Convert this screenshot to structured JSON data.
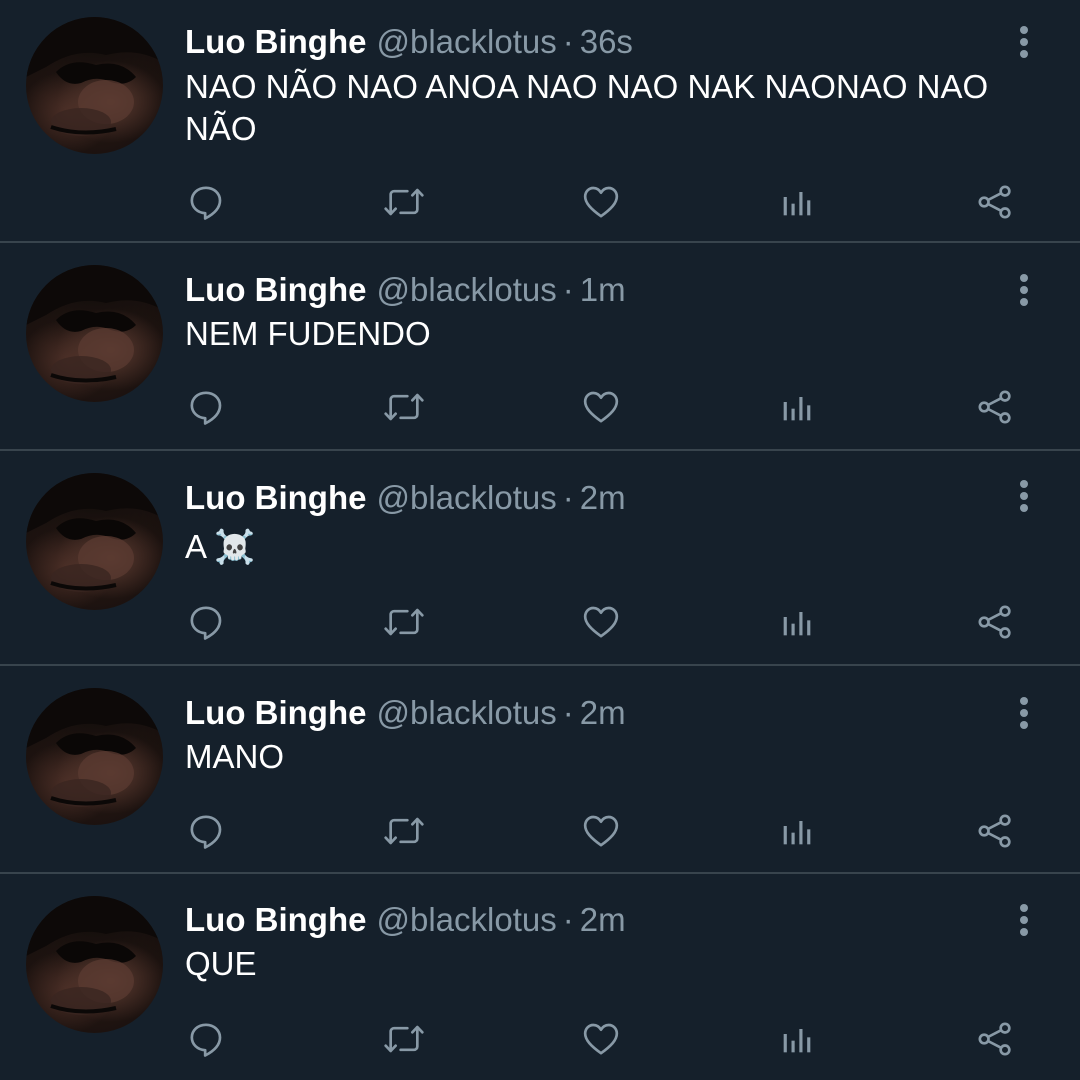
{
  "colors": {
    "background": "#15202b",
    "divider": "#38444d",
    "primary_text": "#ffffff",
    "secondary_text": "#8899a6"
  },
  "separator": "·",
  "tweets": [
    {
      "name": "Luo Binghe",
      "handle": "@blacklotus",
      "time": "36s",
      "text": "NAO NÃO NAO ANOA NAO NAO NAK NAONAO NAO NÃO"
    },
    {
      "name": "Luo Binghe",
      "handle": "@blacklotus",
      "time": "1m",
      "text": "NEM FUDENDO"
    },
    {
      "name": "Luo Binghe",
      "handle": "@blacklotus",
      "time": "2m",
      "text": "A ☠️"
    },
    {
      "name": "Luo Binghe",
      "handle": "@blacklotus",
      "time": "2m",
      "text": "MANO"
    },
    {
      "name": "Luo Binghe",
      "handle": "@blacklotus",
      "time": "2m",
      "text": "QUE"
    }
  ],
  "icons": {
    "avatar": "profile-photo",
    "more": "vertical-ellipsis-icon",
    "reply": "speech-bubble-icon",
    "retweet": "retweet-arrows-icon",
    "like": "heart-icon",
    "stats": "bar-chart-icon",
    "share": "share-nodes-icon"
  }
}
